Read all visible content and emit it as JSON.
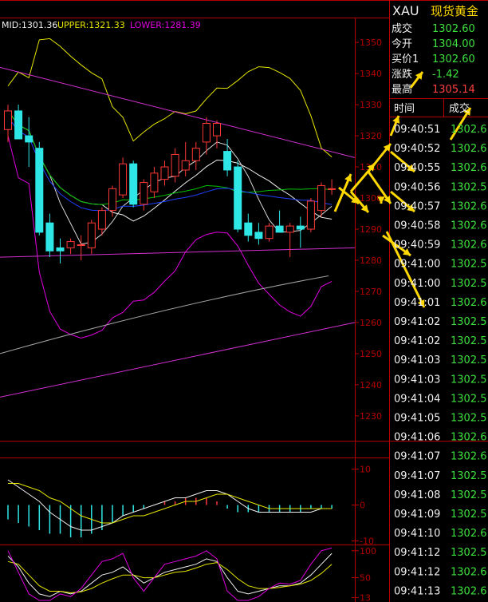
{
  "colors": {
    "bg": "#000000",
    "frame": "#b40000",
    "up": "#ff3838",
    "down": "#2ee6e6",
    "mid": "#f0f0f0",
    "upper": "#e6e600",
    "lower": "#e000e0",
    "ma_green": "#00c000",
    "ma_blue": "#2040ff",
    "ma_white": "#d8d8d8",
    "trend_magenta": "#d030d0",
    "trend_gray": "#a0a0a0",
    "arrow": "#ffd800",
    "ticker_value_green": "#3ce03c",
    "ticker_value_red": "#ff4040"
  },
  "legend": {
    "mid": "MID:1301.36",
    "upper": "UPPER:1321.33",
    "lower": "LOWER:1281.39"
  },
  "y_axis": [
    "1350",
    "1340",
    "1330",
    "1320",
    "1310",
    "1300",
    "1290",
    "1280",
    "1270",
    "1260",
    "1250",
    "1240",
    "1230"
  ],
  "macd_axis": [
    "10",
    "0",
    "-10"
  ],
  "kdj_axis": [
    "100",
    "50",
    "13"
  ],
  "quote": {
    "symbol": "XAU",
    "name": "现货黄金",
    "rows": [
      {
        "label": "成交",
        "value": "1302.60",
        "color": "green"
      },
      {
        "label": "今开",
        "value": "1304.00",
        "color": "green"
      },
      {
        "label": "买价1",
        "value": "1302.60",
        "color": "green"
      },
      {
        "label": "涨跌",
        "value": "-1.42",
        "color": "green"
      },
      {
        "label": "最高",
        "value": "1305.14",
        "color": "red"
      }
    ]
  },
  "ticks_header": {
    "time": "时间",
    "trade": "成交"
  },
  "ticks": [
    {
      "time": "09:40:51",
      "price": "1302.6"
    },
    {
      "time": "09:40:52",
      "price": "1302.6"
    },
    {
      "time": "09:40:55",
      "price": "1302.6"
    },
    {
      "time": "09:40:56",
      "price": "1302.5"
    },
    {
      "time": "09:40:57",
      "price": "1302.6"
    },
    {
      "time": "09:40:58",
      "price": "1302.6"
    },
    {
      "time": "09:40:59",
      "price": "1302.6"
    },
    {
      "time": "09:41:00",
      "price": "1302.5"
    },
    {
      "time": "09:41:00",
      "price": "1302.5"
    },
    {
      "time": "09:41:01",
      "price": "1302.6"
    },
    {
      "time": "09:41:02",
      "price": "1302.5"
    },
    {
      "time": "09:41:02",
      "price": "1302.5"
    },
    {
      "time": "09:41:03",
      "price": "1302.5"
    },
    {
      "time": "09:41:03",
      "price": "1302.5"
    },
    {
      "time": "09:41:04",
      "price": "1302.5"
    },
    {
      "time": "09:41:05",
      "price": "1302.5"
    },
    {
      "time": "09:41:06",
      "price": "1302.6"
    },
    {
      "time": "09:41:07",
      "price": "1302.6"
    },
    {
      "time": "09:41:07",
      "price": "1302.5"
    },
    {
      "time": "09:41:08",
      "price": "1302.5"
    },
    {
      "time": "09:41:09",
      "price": "1302.5"
    },
    {
      "time": "09:41:10",
      "price": "1302.6"
    },
    {
      "time": "09:41:12",
      "price": "1302.5"
    },
    {
      "time": "09:41:12",
      "price": "1302.6"
    },
    {
      "time": "09:41:13",
      "price": "1302.6"
    }
  ],
  "chart_data": {
    "type": "candlestick",
    "price_range": [
      1222,
      1358
    ],
    "candles": [
      {
        "o": 1322,
        "h": 1330,
        "l": 1318,
        "c": 1328
      },
      {
        "o": 1328,
        "h": 1330,
        "l": 1319,
        "c": 1319
      },
      {
        "o": 1320,
        "h": 1326,
        "l": 1310,
        "c": 1318
      },
      {
        "o": 1316,
        "h": 1318,
        "l": 1288,
        "c": 1289
      },
      {
        "o": 1292,
        "h": 1295,
        "l": 1281,
        "c": 1283
      },
      {
        "o": 1284,
        "h": 1287,
        "l": 1279,
        "c": 1283
      },
      {
        "o": 1284,
        "h": 1287,
        "l": 1282,
        "c": 1286
      },
      {
        "o": 1285,
        "h": 1288,
        "l": 1280,
        "c": 1285
      },
      {
        "o": 1284,
        "h": 1293,
        "l": 1282,
        "c": 1292
      },
      {
        "o": 1290,
        "h": 1297,
        "l": 1288,
        "c": 1296
      },
      {
        "o": 1296,
        "h": 1304,
        "l": 1294,
        "c": 1303
      },
      {
        "o": 1301,
        "h": 1313,
        "l": 1300,
        "c": 1311
      },
      {
        "o": 1311,
        "h": 1312,
        "l": 1297,
        "c": 1298
      },
      {
        "o": 1298,
        "h": 1306,
        "l": 1296,
        "c": 1305
      },
      {
        "o": 1302,
        "h": 1310,
        "l": 1300,
        "c": 1308
      },
      {
        "o": 1306,
        "h": 1312,
        "l": 1304,
        "c": 1310
      },
      {
        "o": 1307,
        "h": 1316,
        "l": 1305,
        "c": 1314
      },
      {
        "o": 1309,
        "h": 1318,
        "l": 1307,
        "c": 1312
      },
      {
        "o": 1312,
        "h": 1318,
        "l": 1309,
        "c": 1316
      },
      {
        "o": 1318,
        "h": 1326,
        "l": 1314,
        "c": 1324
      },
      {
        "o": 1320,
        "h": 1325,
        "l": 1316,
        "c": 1324
      },
      {
        "o": 1315,
        "h": 1319,
        "l": 1307,
        "c": 1309
      },
      {
        "o": 1310,
        "h": 1312,
        "l": 1289,
        "c": 1290
      },
      {
        "o": 1292,
        "h": 1295,
        "l": 1286,
        "c": 1288
      },
      {
        "o": 1289,
        "h": 1292,
        "l": 1285,
        "c": 1287
      },
      {
        "o": 1287,
        "h": 1292,
        "l": 1286,
        "c": 1291
      },
      {
        "o": 1291,
        "h": 1296,
        "l": 1289,
        "c": 1289
      },
      {
        "o": 1289,
        "h": 1292,
        "l": 1281,
        "c": 1291
      },
      {
        "o": 1291,
        "h": 1294,
        "l": 1284,
        "c": 1290
      },
      {
        "o": 1290,
        "h": 1300,
        "l": 1289,
        "c": 1299
      },
      {
        "o": 1296,
        "h": 1305,
        "l": 1294,
        "c": 1304
      },
      {
        "o": 1303,
        "h": 1306,
        "l": 1301,
        "c": 1303
      }
    ],
    "macd": {
      "range": [
        -11,
        13
      ],
      "hist": [
        -4,
        -5,
        -6,
        -7,
        -8,
        -8,
        -9,
        -9,
        -8,
        -7,
        -5,
        -3,
        -2,
        -1,
        0,
        1,
        1,
        2,
        2,
        2,
        1,
        -1,
        -2,
        -2,
        -2,
        -2,
        -2,
        -2,
        -2,
        -1,
        -1,
        -1
      ],
      "dif": [
        7,
        5,
        3,
        1,
        -2,
        -4,
        -6,
        -7,
        -7,
        -6,
        -5,
        -3,
        -2,
        -1,
        0,
        1,
        2,
        2,
        3,
        4,
        4,
        3,
        1,
        -1,
        -2,
        -2,
        -2,
        -2,
        -2,
        -2,
        -1,
        -1
      ],
      "dea": [
        6,
        6,
        5,
        4,
        2,
        1,
        -1,
        -3,
        -4,
        -5,
        -5,
        -4,
        -3,
        -3,
        -2,
        -1,
        0,
        1,
        1,
        2,
        3,
        3,
        2,
        1,
        0,
        -1,
        -1,
        -1,
        -1,
        -1,
        -1,
        -1
      ]
    },
    "kdj": {
      "range": [
        5,
        110
      ],
      "k": [
        90,
        70,
        40,
        20,
        15,
        25,
        20,
        25,
        40,
        55,
        60,
        70,
        55,
        40,
        50,
        60,
        65,
        70,
        75,
        85,
        80,
        50,
        25,
        20,
        25,
        30,
        35,
        35,
        40,
        55,
        75,
        95
      ],
      "d": [
        80,
        75,
        55,
        35,
        25,
        25,
        22,
        24,
        30,
        40,
        48,
        55,
        55,
        50,
        50,
        55,
        60,
        62,
        68,
        75,
        78,
        65,
        48,
        35,
        30,
        30,
        32,
        35,
        38,
        45,
        58,
        75
      ],
      "j": [
        100,
        60,
        20,
        8,
        8,
        20,
        15,
        30,
        55,
        80,
        85,
        95,
        50,
        25,
        50,
        75,
        80,
        85,
        90,
        100,
        85,
        25,
        8,
        8,
        15,
        30,
        40,
        38,
        45,
        75,
        100,
        105
      ]
    }
  }
}
